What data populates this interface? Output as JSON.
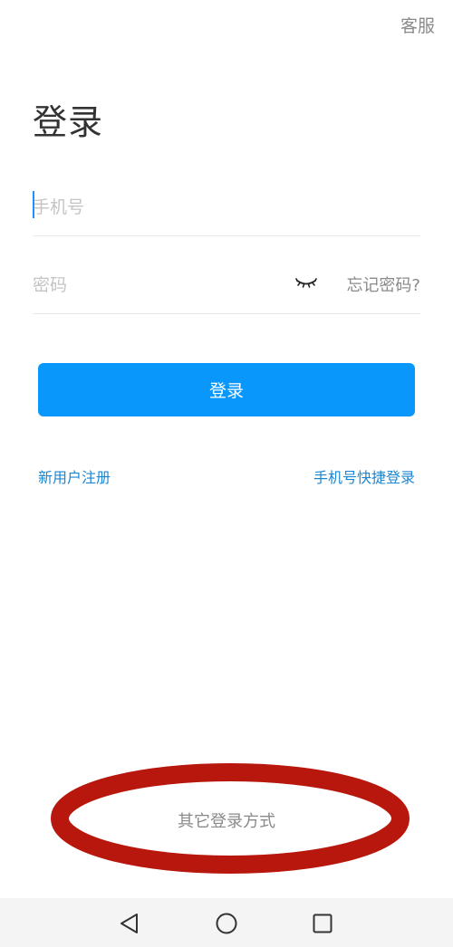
{
  "header": {
    "customer_service": "客服"
  },
  "page": {
    "title": "登录"
  },
  "form": {
    "phone_placeholder": "手机号",
    "phone_value": "",
    "password_placeholder": "密码",
    "password_value": "",
    "forgot_password": "忘记密码?",
    "eye_icon": "eye-closed-icon",
    "login_button": "登录"
  },
  "links": {
    "register": "新用户注册",
    "quick_login": "手机号快捷登录"
  },
  "footer": {
    "other_login": "其它登录方式"
  },
  "colors": {
    "primary": "#0a97fb",
    "link": "#1d86d1",
    "annotation": "#b8170d"
  },
  "nav": {
    "back_icon": "back-triangle-icon",
    "home_icon": "home-circle-icon",
    "recent_icon": "recent-square-icon"
  }
}
